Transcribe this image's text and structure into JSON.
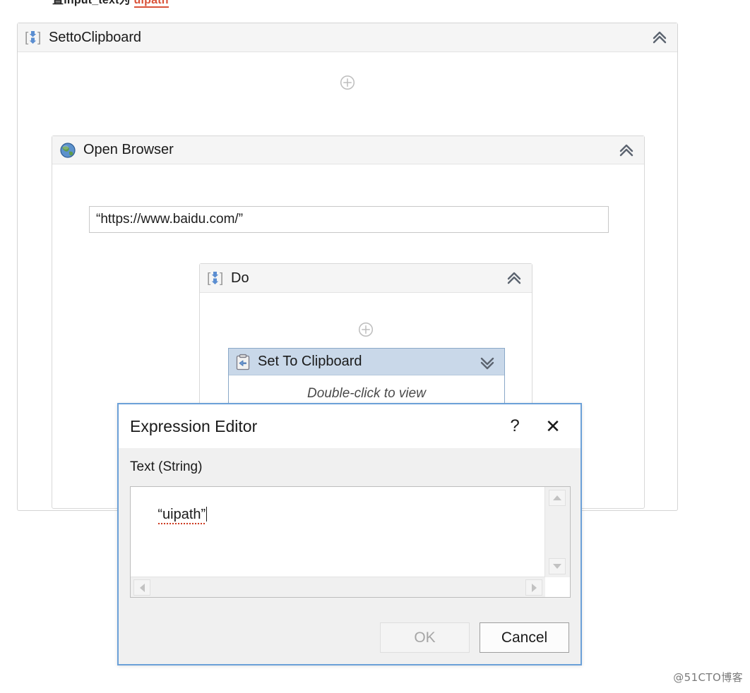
{
  "caption": {
    "prefix": "置input_text为 ",
    "highlight": "uipath"
  },
  "sequence": {
    "icon": "sequence-icon",
    "title": "SettoClipboard",
    "collapse_icon": "chevron-double-up-icon",
    "plus_icon": "plus-circle-icon"
  },
  "open_browser": {
    "icon": "globe-icon",
    "title": "Open Browser",
    "collapse_icon": "chevron-double-up-icon",
    "url_value": "“https://www.baidu.com/”"
  },
  "do_sequence": {
    "icon": "sequence-icon",
    "title": "Do",
    "collapse_icon": "chevron-double-up-icon",
    "plus_icon": "plus-circle-icon"
  },
  "clipboard_activity": {
    "icon": "clipboard-arrow-icon",
    "title": "Set To Clipboard",
    "expand_icon": "chevron-double-down-icon",
    "body_hint": "Double-click to view",
    "selected": true
  },
  "expression_editor": {
    "title": "Expression Editor",
    "help_label": "?",
    "close_label": "✕",
    "field_label": "Text (String)",
    "expression_value": "“uipath”",
    "buttons": {
      "ok": "OK",
      "ok_enabled": false,
      "cancel": "Cancel",
      "cancel_enabled": true
    },
    "scrollbars": {
      "up": "scroll-up-arrow",
      "down": "scroll-down-arrow",
      "left": "scroll-left-arrow",
      "right": "scroll-right-arrow"
    }
  },
  "watermark": "@51CTO博客",
  "colors": {
    "selection_header": "#c9d8e9",
    "selection_border": "#8aa8c8",
    "dialog_border": "#6ba0d8",
    "panel_header": "#f5f5f5",
    "spellcheck_underline": "#cc3b22",
    "highlight_text": "#d9533a"
  }
}
